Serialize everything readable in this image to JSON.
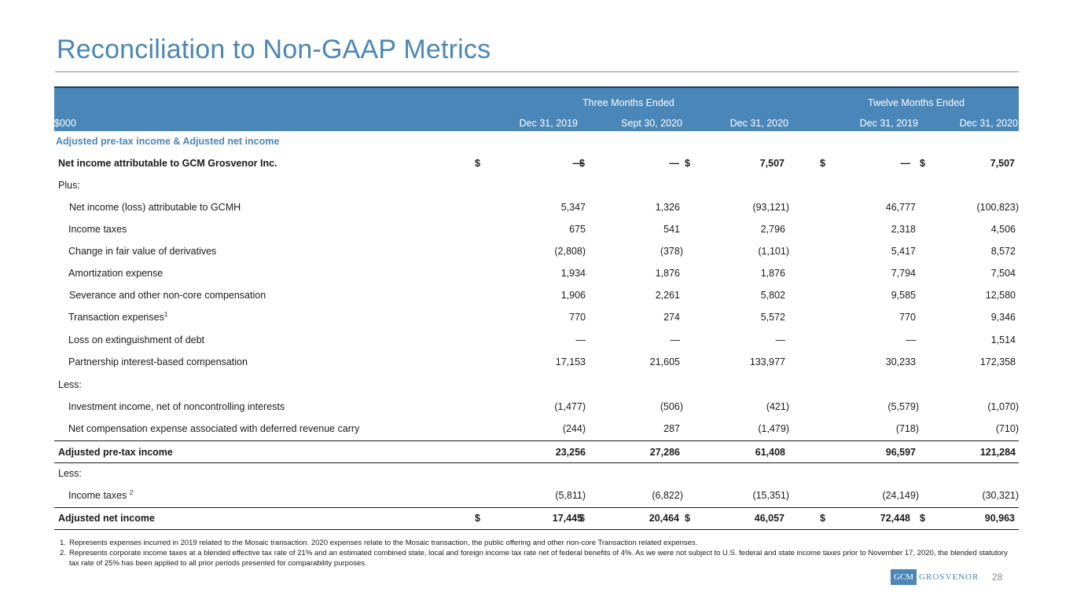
{
  "title": "Reconciliation to Non-GAAP Metrics",
  "header": {
    "unit": "$000",
    "group_three": "Three Months Ended",
    "group_twelve": "Twelve Months Ended",
    "columns": [
      "Dec 31, 2019",
      "Sept 30, 2020",
      "Dec 31, 2020",
      "Dec 31, 2019",
      "Dec 31, 2020"
    ]
  },
  "section_label": "Adjusted pre-tax income & Adjusted net income",
  "rows": [
    {
      "label": "Net income attributable to GCM Grosvenor Inc.",
      "values": [
        "—",
        "—",
        "7,507",
        "—",
        "7,507"
      ],
      "currency": "$"
    },
    {
      "label": "Plus:"
    },
    {
      "label": "Net income (loss) attributable to GCMH",
      "values": [
        "5,347",
        "1,326",
        "(93,121)",
        "46,777",
        "(100,823)"
      ]
    },
    {
      "label": "Income taxes",
      "values": [
        "675",
        "541",
        "2,796",
        "2,318",
        "4,506"
      ]
    },
    {
      "label": "Change in fair value of derivatives",
      "values": [
        "(2,808)",
        "(378)",
        "(1,101)",
        "5,417",
        "8,572"
      ]
    },
    {
      "label": "Amortization expense",
      "values": [
        "1,934",
        "1,876",
        "1,876",
        "7,794",
        "7,504"
      ]
    },
    {
      "label": "Severance and other non-core compensation",
      "values": [
        "1,906",
        "2,261",
        "5,802",
        "9,585",
        "12,580"
      ]
    },
    {
      "label": "Transaction expenses",
      "footnote": "1",
      "values": [
        "770",
        "274",
        "5,572",
        "770",
        "9,346"
      ]
    },
    {
      "label": "Loss on extinguishment of debt",
      "values": [
        "—",
        "—",
        "—",
        "—",
        "1,514"
      ]
    },
    {
      "label": "Partnership interest-based compensation",
      "values": [
        "17,153",
        "21,605",
        "133,977",
        "30,233",
        "172,358"
      ]
    },
    {
      "label": "Less:"
    },
    {
      "label": "Investment income, net of noncontrolling interests",
      "values": [
        "(1,477)",
        "(506)",
        "(421)",
        "(5,579)",
        "(1,070)"
      ]
    },
    {
      "label": "Net compensation expense associated with deferred revenue carry",
      "values": [
        "(244)",
        "287",
        "(1,479)",
        "(718)",
        "(710)"
      ]
    },
    {
      "label": "Adjusted pre-tax income",
      "values": [
        "23,256",
        "27,286",
        "61,408",
        "96,597",
        "121,284"
      ]
    },
    {
      "label": "Less:"
    },
    {
      "label": "Income taxes ",
      "footnote": "2",
      "values": [
        "(5,811)",
        "(6,822)",
        "(15,351)",
        "(24,149)",
        "(30,321)"
      ]
    },
    {
      "label": "Adjusted net income",
      "values": [
        "17,445",
        "20,464",
        "46,057",
        "72,448",
        "90,963"
      ],
      "currency": "$"
    }
  ],
  "notes": [
    {
      "num": "1.",
      "text": "Represents expenses incurred in 2019 related to the Mosaic transaction. 2020 expenses relate to the Mosaic transaction, the public offering and other non-core Transaction related expenses."
    },
    {
      "num": "2.",
      "text": "Represents corporate income taxes at a blended effective tax rate of 21% and an estimated combined state, local and foreign income tax rate net of federal benefits of 4%. As we were not subject to U.S. federal and state income taxes prior to November 17, 2020, the blended statutory tax rate of 25% has been applied to all prior periods presented for comparability purposes."
    }
  ],
  "logo": {
    "box": "GCM",
    "word": "GROSVENOR"
  },
  "page_number": "28",
  "colors": {
    "accent": "#4a86b8",
    "header_border": "#1f3f63"
  }
}
